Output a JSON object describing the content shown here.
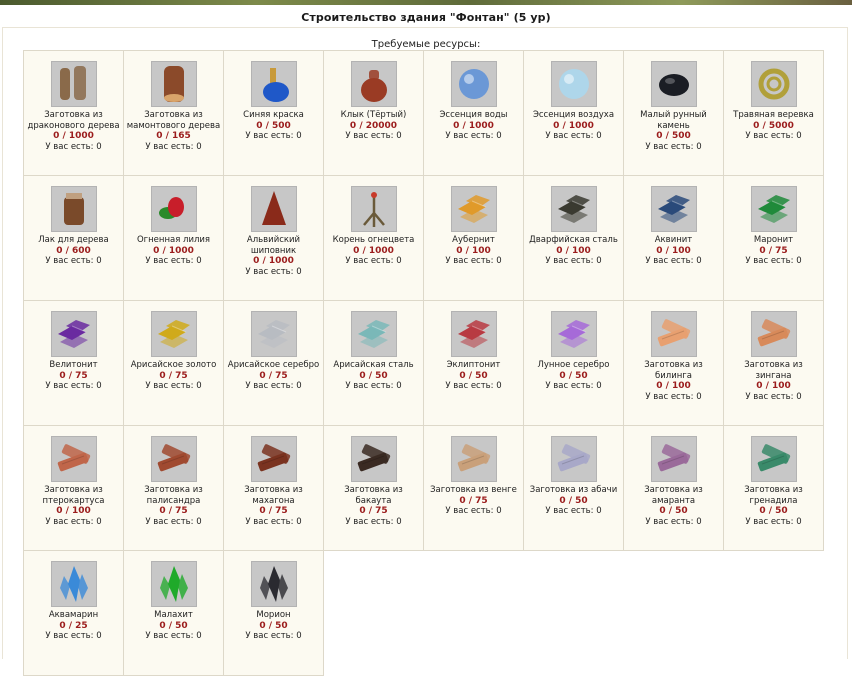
{
  "header": {
    "title": "Строительство здания \"Фонтан\" (5 ур)",
    "subtitle": "Требуемые ресурсы:"
  },
  "have_label": "У вас есть: 0",
  "resources": [
    {
      "name": "Заготовка из драконового дерева",
      "qty": "0 / 1000",
      "icon": "logs-icon",
      "color": "#8a6a4a"
    },
    {
      "name": "Заготовка из мамонтового дерева",
      "qty": "0 / 165",
      "icon": "log-icon",
      "color": "#8b4a2a"
    },
    {
      "name": "Синяя краска",
      "qty": "0 / 500",
      "icon": "blue-paint-icon",
      "color": "#1f58c8"
    },
    {
      "name": "Клык (Тёртый)",
      "qty": "0 / 20000",
      "icon": "pouch-icon",
      "color": "#9a3b24"
    },
    {
      "name": "Эссенция воды",
      "qty": "0 / 1000",
      "icon": "water-essence-icon",
      "color": "#5b8fd8"
    },
    {
      "name": "Эссенция воздуха",
      "qty": "0 / 1000",
      "icon": "air-essence-icon",
      "color": "#a9d8f0"
    },
    {
      "name": "Малый рунный камень",
      "qty": "0 / 500",
      "icon": "rune-stone-icon",
      "color": "#1a1d24"
    },
    {
      "name": "Травяная веревка",
      "qty": "0 / 5000",
      "icon": "rope-icon",
      "color": "#b1a03a"
    },
    {
      "name": "Лак для дерева",
      "qty": "0 / 600",
      "icon": "varnish-jar-icon",
      "color": "#7a4a2a"
    },
    {
      "name": "Огненная лилия",
      "qty": "0 / 1000",
      "icon": "fire-lily-icon",
      "color": "#c81e2a"
    },
    {
      "name": "Альвийский шиповник",
      "qty": "0 / 1000",
      "icon": "briar-icon",
      "color": "#8a2a1a"
    },
    {
      "name": "Корень огнецвета",
      "qty": "0 / 1000",
      "icon": "root-icon",
      "color": "#6a5a3a"
    },
    {
      "name": "Аубернит",
      "qty": "0 / 100",
      "icon": "ingot-icon",
      "color": "#e09a2a"
    },
    {
      "name": "Дварфийская сталь",
      "qty": "0 / 100",
      "icon": "ingot-icon",
      "color": "#3a3a30"
    },
    {
      "name": "Аквинит",
      "qty": "0 / 100",
      "icon": "ingot-icon",
      "color": "#2a4a7a"
    },
    {
      "name": "Маронит",
      "qty": "0 / 75",
      "icon": "ingot-icon",
      "color": "#1f8a3a"
    },
    {
      "name": "Велитонит",
      "qty": "0 / 75",
      "icon": "ingot-icon",
      "color": "#6a2aa0"
    },
    {
      "name": "Арисайское золото",
      "qty": "0 / 75",
      "icon": "ingot-icon",
      "color": "#d0aa1a"
    },
    {
      "name": "Арисайское серебро",
      "qty": "0 / 75",
      "icon": "ingot-icon",
      "color": "#b8bcc2"
    },
    {
      "name": "Арисайская сталь",
      "qty": "0 / 50",
      "icon": "ingot-icon",
      "color": "#7ab8b8"
    },
    {
      "name": "Эклиптонит",
      "qty": "0 / 50",
      "icon": "ingot-icon",
      "color": "#b83a42"
    },
    {
      "name": "Лунное серебро",
      "qty": "0 / 50",
      "icon": "ingot-icon",
      "color": "#a66ad8"
    },
    {
      "name": "Заготовка из билинга",
      "qty": "0 / 100",
      "icon": "plank-icon",
      "color": "#e8a070"
    },
    {
      "name": "Заготовка из зингана",
      "qty": "0 / 100",
      "icon": "plank-icon",
      "color": "#d88a5a"
    },
    {
      "name": "Заготовка из птерокартуса",
      "qty": "0 / 100",
      "icon": "plank-icon",
      "color": "#c0664a"
    },
    {
      "name": "Заготовка из палисандра",
      "qty": "0 / 75",
      "icon": "plank-icon",
      "color": "#a04a30"
    },
    {
      "name": "Заготовка из махагона",
      "qty": "0 / 75",
      "icon": "plank-icon",
      "color": "#7a3320"
    },
    {
      "name": "Заготовка из бакаута",
      "qty": "0 / 75",
      "icon": "plank-icon",
      "color": "#3a2a22"
    },
    {
      "name": "Заготовка из венге",
      "qty": "0 / 75",
      "icon": "plank-icon",
      "color": "#c9a07a"
    },
    {
      "name": "Заготовка из абачи",
      "qty": "0 / 50",
      "icon": "plank-icon",
      "color": "#a8a8c8"
    },
    {
      "name": "Заготовка из амаранта",
      "qty": "0 / 50",
      "icon": "plank-icon",
      "color": "#9a6a9a"
    },
    {
      "name": "Заготовка из гренадила",
      "qty": "0 / 50",
      "icon": "plank-icon",
      "color": "#3a8a6a"
    },
    {
      "name": "Аквамарин",
      "qty": "0 / 25",
      "icon": "crystal-icon",
      "color": "#3a8ad8"
    },
    {
      "name": "Малахит",
      "qty": "0 / 50",
      "icon": "crystal-icon",
      "color": "#1faa2a"
    },
    {
      "name": "Морион",
      "qty": "0 / 50",
      "icon": "crystal-icon",
      "color": "#2a2a30"
    }
  ]
}
